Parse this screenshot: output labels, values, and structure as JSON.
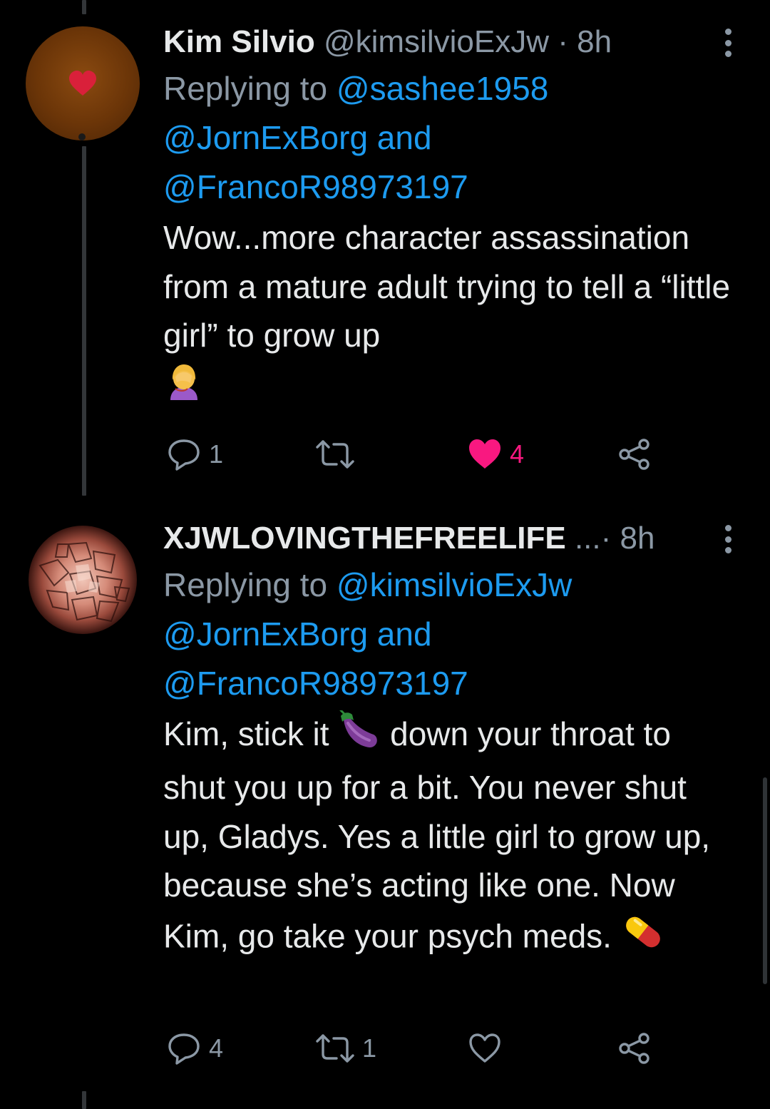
{
  "tweets": [
    {
      "display_name": "Kim Silvio",
      "handle": "@kimsilvioExJw",
      "separator": "·",
      "time": "8h",
      "replying_prefix": "Replying to ",
      "mention_1": "@sashee1958",
      "mention_2": "@JornExBorg",
      "mention_joiner": " and",
      "mention_3": "@FrancoR98973197",
      "text": "Wow...more character assassination from a mature adult trying to tell a “little girl” to grow up",
      "reply_count": "1",
      "retweet_count": "",
      "like_count": "4",
      "liked": true,
      "avatar_icon": "heart-icon"
    },
    {
      "display_name": "XJWLOVINGTHEFREELIFE",
      "name_ellipsis": " ...",
      "separator": "·",
      "time": "8h",
      "replying_prefix": "Replying to ",
      "mention_1": "@kimsilvioExJw",
      "mention_2": "@JornExBorg",
      "mention_joiner": " and",
      "mention_3": "@FrancoR98973197",
      "text_part_1": "Kim, stick it ",
      "text_part_2": " down your throat to shut you up for a bit. You never shut up, Gladys. Yes a little girl to grow up, because she’s acting like one. Now Kim, go take your psych meds. ",
      "reply_count": "4",
      "retweet_count": "1",
      "like_count": "",
      "liked": false
    }
  ],
  "colors": {
    "background": "#000000",
    "text_primary": "#e7e9ea",
    "text_secondary": "#8b98a5",
    "link": "#1d9bf0",
    "like_active": "#f91880",
    "thread_line": "#333639"
  }
}
